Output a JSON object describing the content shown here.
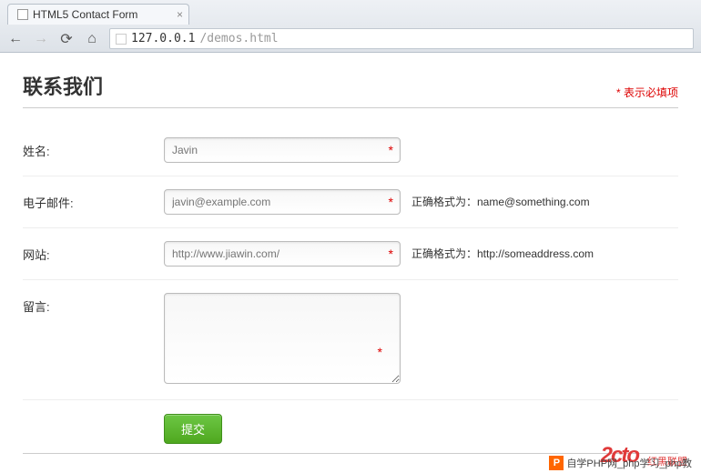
{
  "browser": {
    "tab_title": "HTML5 Contact Form",
    "url_host": "127.0.0.1",
    "url_path": "/demos.html"
  },
  "page": {
    "title": "联系我们",
    "required_note": "* 表示必填项"
  },
  "form": {
    "name_label": "姓名:",
    "name_placeholder": "Javin",
    "email_label": "电子邮件:",
    "email_placeholder": "javin@example.com",
    "email_hint": "正确格式为：name@something.com",
    "website_label": "网站:",
    "website_placeholder": "http://www.jiawin.com/",
    "website_hint": "正确格式为：http://someaddress.com",
    "message_label": "留言:",
    "submit_label": "提交"
  },
  "footer": {
    "red_logo": "2cto",
    "red_logo_text": "红黑联盟",
    "php_text": "自学PHP网_php学习_php教"
  }
}
